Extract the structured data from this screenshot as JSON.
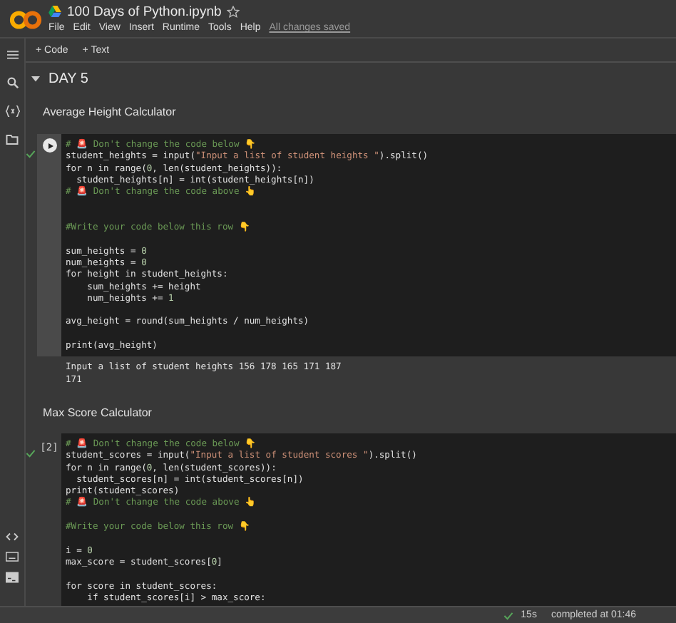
{
  "header": {
    "title": "100 Days of Python.ipynb",
    "starred": false,
    "menu": [
      "File",
      "Edit",
      "View",
      "Insert",
      "Runtime",
      "Tools",
      "Help"
    ],
    "save_status": "All changes saved"
  },
  "toolbar": {
    "buttons": [
      "+ Code",
      "+ Text"
    ]
  },
  "section": {
    "title": "DAY 5",
    "expanded": true
  },
  "cells": [
    {
      "kind": "text",
      "text": "Average Height Calculator"
    },
    {
      "kind": "code",
      "selected": true,
      "ran": true,
      "blocks": [
        {
          "kind": "first",
          "lines": [
            "# 🚨 Don't change the code below 👇",
            "student_heights = input(\"Input a list of student heights \").split()",
            "for n in range(0, len(student_heights)):",
            "  student_heights[n] = int(student_heights[n])",
            "# 🚨 Don't change the code above 👆"
          ]
        },
        {
          "kind": "double_spaced",
          "lines": [
            "#Write your code below this row 👇"
          ]
        },
        {
          "kind": "spaced",
          "lines": [
            "sum_heights = 0",
            "num_heights = 0",
            "for height in student_heights:",
            "    sum_heights += height",
            "    num_heights += 1"
          ]
        },
        {
          "kind": "spaced",
          "lines": [
            "avg_height = round(sum_heights / num_heights)"
          ]
        },
        {
          "kind": "spaced",
          "lines": [
            "print(avg_height)"
          ]
        }
      ],
      "output": [
        "Input a list of student heights 156 178 165 171 187",
        "171"
      ]
    },
    {
      "kind": "text",
      "text": "Max Score Calculator"
    },
    {
      "kind": "code",
      "selected": false,
      "ran": true,
      "execution_count": "[2]",
      "blocks": [
        {
          "kind": "first",
          "lines": [
            "# 🚨 Don't change the code below 👇",
            "student_scores = input(\"Input a list of student scores \").split()",
            "for n in range(0, len(student_scores)):",
            "  student_scores[n] = int(student_scores[n])",
            "print(student_scores)",
            "# 🚨 Don't change the code above 👆"
          ]
        },
        {
          "kind": "spaced",
          "lines": [
            "#Write your code below this row 👇"
          ]
        },
        {
          "kind": "spaced",
          "lines": [
            "i = 0",
            "max_score = student_scores[0]"
          ]
        },
        {
          "kind": "spaced",
          "lines": [
            "for score in student_scores:",
            "    if student_scores[i] > max_score:"
          ]
        }
      ]
    }
  ],
  "status_bar": {
    "duration": "15s",
    "message": "completed at 01:46"
  }
}
